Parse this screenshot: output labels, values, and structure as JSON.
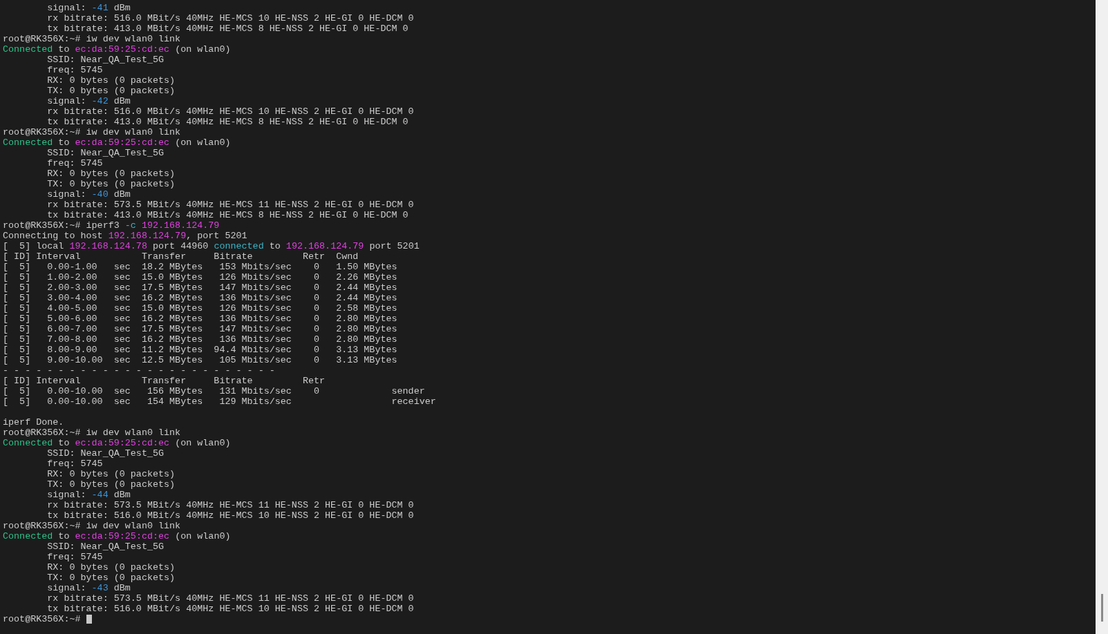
{
  "terminal": {
    "lines": [
      {
        "indent": true,
        "segments": [
          {
            "kind": "text",
            "text": "signal: "
          },
          {
            "kind": "number",
            "text": "-41"
          },
          {
            "kind": "text",
            "text": " dBm"
          }
        ]
      },
      {
        "indent": true,
        "segments": [
          {
            "kind": "text",
            "text": "rx bitrate: 516.0 MBit/s 40MHz HE-MCS 10 HE-NSS 2 HE-GI 0 HE-DCM 0"
          }
        ]
      },
      {
        "indent": true,
        "segments": [
          {
            "kind": "text",
            "text": "tx bitrate: 413.0 MBit/s 40MHz HE-MCS 8 HE-NSS 2 HE-GI 0 HE-DCM 0"
          }
        ]
      },
      {
        "indent": false,
        "segments": [
          {
            "kind": "text",
            "text": "root@RK356X:~# iw dev wlan0 link"
          }
        ]
      },
      {
        "indent": false,
        "segments": [
          {
            "kind": "status",
            "text": "Connected"
          },
          {
            "kind": "text",
            "text": " to "
          },
          {
            "kind": "address",
            "text": "ec:da:59:25:cd:ec"
          },
          {
            "kind": "text",
            "text": " (on wlan0)"
          }
        ]
      },
      {
        "indent": true,
        "segments": [
          {
            "kind": "text",
            "text": "SSID: Near_QA_Test_5G"
          }
        ]
      },
      {
        "indent": true,
        "segments": [
          {
            "kind": "text",
            "text": "freq: 5745"
          }
        ]
      },
      {
        "indent": true,
        "segments": [
          {
            "kind": "text",
            "text": "RX: 0 bytes (0 packets)"
          }
        ]
      },
      {
        "indent": true,
        "segments": [
          {
            "kind": "text",
            "text": "TX: 0 bytes (0 packets)"
          }
        ]
      },
      {
        "indent": true,
        "segments": [
          {
            "kind": "text",
            "text": "signal: "
          },
          {
            "kind": "number",
            "text": "-42"
          },
          {
            "kind": "text",
            "text": " dBm"
          }
        ]
      },
      {
        "indent": true,
        "segments": [
          {
            "kind": "text",
            "text": "rx bitrate: 516.0 MBit/s 40MHz HE-MCS 10 HE-NSS 2 HE-GI 0 HE-DCM 0"
          }
        ]
      },
      {
        "indent": true,
        "segments": [
          {
            "kind": "text",
            "text": "tx bitrate: 413.0 MBit/s 40MHz HE-MCS 8 HE-NSS 2 HE-GI 0 HE-DCM 0"
          }
        ]
      },
      {
        "indent": false,
        "segments": [
          {
            "kind": "text",
            "text": "root@RK356X:~# iw dev wlan0 link"
          }
        ]
      },
      {
        "indent": false,
        "segments": [
          {
            "kind": "status",
            "text": "Connected"
          },
          {
            "kind": "text",
            "text": " to "
          },
          {
            "kind": "address",
            "text": "ec:da:59:25:cd:ec"
          },
          {
            "kind": "text",
            "text": " (on wlan0)"
          }
        ]
      },
      {
        "indent": true,
        "segments": [
          {
            "kind": "text",
            "text": "SSID: Near_QA_Test_5G"
          }
        ]
      },
      {
        "indent": true,
        "segments": [
          {
            "kind": "text",
            "text": "freq: 5745"
          }
        ]
      },
      {
        "indent": true,
        "segments": [
          {
            "kind": "text",
            "text": "RX: 0 bytes (0 packets)"
          }
        ]
      },
      {
        "indent": true,
        "segments": [
          {
            "kind": "text",
            "text": "TX: 0 bytes (0 packets)"
          }
        ]
      },
      {
        "indent": true,
        "segments": [
          {
            "kind": "text",
            "text": "signal: "
          },
          {
            "kind": "number",
            "text": "-40"
          },
          {
            "kind": "text",
            "text": " dBm"
          }
        ]
      },
      {
        "indent": true,
        "segments": [
          {
            "kind": "text",
            "text": "rx bitrate: 573.5 MBit/s 40MHz HE-MCS 11 HE-NSS 2 HE-GI 0 HE-DCM 0"
          }
        ]
      },
      {
        "indent": true,
        "segments": [
          {
            "kind": "text",
            "text": "tx bitrate: 413.0 MBit/s 40MHz HE-MCS 8 HE-NSS 2 HE-GI 0 HE-DCM 0"
          }
        ]
      },
      {
        "indent": false,
        "segments": [
          {
            "kind": "text",
            "text": "root@RK356X:~# iperf3 "
          },
          {
            "kind": "keyword",
            "text": "-c "
          },
          {
            "kind": "address",
            "text": "192.168.124.79"
          }
        ]
      },
      {
        "indent": false,
        "segments": [
          {
            "kind": "text",
            "text": "Connecting to host "
          },
          {
            "kind": "address",
            "text": "192.168.124.79"
          },
          {
            "kind": "text",
            "text": ", port 5201"
          }
        ]
      },
      {
        "indent": false,
        "segments": [
          {
            "kind": "text",
            "text": "[  5] local "
          },
          {
            "kind": "address",
            "text": "192.168.124.78"
          },
          {
            "kind": "text",
            "text": " port 44960 "
          },
          {
            "kind": "keyword",
            "text": "connected"
          },
          {
            "kind": "text",
            "text": " to "
          },
          {
            "kind": "address",
            "text": "192.168.124.79"
          },
          {
            "kind": "text",
            "text": " port 5201"
          }
        ]
      },
      {
        "indent": false,
        "segments": [
          {
            "kind": "text",
            "text": "[ ID] Interval           Transfer     Bitrate         Retr  Cwnd"
          }
        ]
      },
      {
        "indent": false,
        "segments": [
          {
            "kind": "text",
            "text": "[  5]   0.00-1.00   sec  18.2 MBytes   153 Mbits/sec    0   1.50 MBytes"
          }
        ]
      },
      {
        "indent": false,
        "segments": [
          {
            "kind": "text",
            "text": "[  5]   1.00-2.00   sec  15.0 MBytes   126 Mbits/sec    0   2.26 MBytes"
          }
        ]
      },
      {
        "indent": false,
        "segments": [
          {
            "kind": "text",
            "text": "[  5]   2.00-3.00   sec  17.5 MBytes   147 Mbits/sec    0   2.44 MBytes"
          }
        ]
      },
      {
        "indent": false,
        "segments": [
          {
            "kind": "text",
            "text": "[  5]   3.00-4.00   sec  16.2 MBytes   136 Mbits/sec    0   2.44 MBytes"
          }
        ]
      },
      {
        "indent": false,
        "segments": [
          {
            "kind": "text",
            "text": "[  5]   4.00-5.00   sec  15.0 MBytes   126 Mbits/sec    0   2.58 MBytes"
          }
        ]
      },
      {
        "indent": false,
        "segments": [
          {
            "kind": "text",
            "text": "[  5]   5.00-6.00   sec  16.2 MBytes   136 Mbits/sec    0   2.80 MBytes"
          }
        ]
      },
      {
        "indent": false,
        "segments": [
          {
            "kind": "text",
            "text": "[  5]   6.00-7.00   sec  17.5 MBytes   147 Mbits/sec    0   2.80 MBytes"
          }
        ]
      },
      {
        "indent": false,
        "segments": [
          {
            "kind": "text",
            "text": "[  5]   7.00-8.00   sec  16.2 MBytes   136 Mbits/sec    0   2.80 MBytes"
          }
        ]
      },
      {
        "indent": false,
        "segments": [
          {
            "kind": "text",
            "text": "[  5]   8.00-9.00   sec  11.2 MBytes  94.4 Mbits/sec    0   3.13 MBytes"
          }
        ]
      },
      {
        "indent": false,
        "segments": [
          {
            "kind": "text",
            "text": "[  5]   9.00-10.00  sec  12.5 MBytes   105 Mbits/sec    0   3.13 MBytes"
          }
        ]
      },
      {
        "indent": false,
        "segments": [
          {
            "kind": "text",
            "text": "- - - - - - - - - - - - - - - - - - - - - - - - -"
          }
        ]
      },
      {
        "indent": false,
        "segments": [
          {
            "kind": "text",
            "text": "[ ID] Interval           Transfer     Bitrate         Retr"
          }
        ]
      },
      {
        "indent": false,
        "segments": [
          {
            "kind": "text",
            "text": "[  5]   0.00-10.00  sec   156 MBytes   131 Mbits/sec    0             sender"
          }
        ]
      },
      {
        "indent": false,
        "segments": [
          {
            "kind": "text",
            "text": "[  5]   0.00-10.00  sec   154 MBytes   129 Mbits/sec                  receiver"
          }
        ]
      },
      {
        "indent": false,
        "gap_before": true,
        "segments": [
          {
            "kind": "text",
            "text": "iperf Done."
          }
        ]
      },
      {
        "indent": false,
        "segments": [
          {
            "kind": "text",
            "text": "root@RK356X:~# iw dev wlan0 link"
          }
        ]
      },
      {
        "indent": false,
        "segments": [
          {
            "kind": "status",
            "text": "Connected"
          },
          {
            "kind": "text",
            "text": " to "
          },
          {
            "kind": "address",
            "text": "ec:da:59:25:cd:ec"
          },
          {
            "kind": "text",
            "text": " (on wlan0)"
          }
        ]
      },
      {
        "indent": true,
        "segments": [
          {
            "kind": "text",
            "text": "SSID: Near_QA_Test_5G"
          }
        ]
      },
      {
        "indent": true,
        "segments": [
          {
            "kind": "text",
            "text": "freq: 5745"
          }
        ]
      },
      {
        "indent": true,
        "segments": [
          {
            "kind": "text",
            "text": "RX: 0 bytes (0 packets)"
          }
        ]
      },
      {
        "indent": true,
        "segments": [
          {
            "kind": "text",
            "text": "TX: 0 bytes (0 packets)"
          }
        ]
      },
      {
        "indent": true,
        "segments": [
          {
            "kind": "text",
            "text": "signal: "
          },
          {
            "kind": "number",
            "text": "-44"
          },
          {
            "kind": "text",
            "text": " dBm"
          }
        ]
      },
      {
        "indent": true,
        "segments": [
          {
            "kind": "text",
            "text": "rx bitrate: 573.5 MBit/s 40MHz HE-MCS 11 HE-NSS 2 HE-GI 0 HE-DCM 0"
          }
        ]
      },
      {
        "indent": true,
        "segments": [
          {
            "kind": "text",
            "text": "tx bitrate: 516.0 MBit/s 40MHz HE-MCS 10 HE-NSS 2 HE-GI 0 HE-DCM 0"
          }
        ]
      },
      {
        "indent": false,
        "segments": [
          {
            "kind": "text",
            "text": "root@RK356X:~# iw dev wlan0 link"
          }
        ]
      },
      {
        "indent": false,
        "segments": [
          {
            "kind": "status",
            "text": "Connected"
          },
          {
            "kind": "text",
            "text": " to "
          },
          {
            "kind": "address",
            "text": "ec:da:59:25:cd:ec"
          },
          {
            "kind": "text",
            "text": " (on wlan0)"
          }
        ]
      },
      {
        "indent": true,
        "segments": [
          {
            "kind": "text",
            "text": "SSID: Near_QA_Test_5G"
          }
        ]
      },
      {
        "indent": true,
        "segments": [
          {
            "kind": "text",
            "text": "freq: 5745"
          }
        ]
      },
      {
        "indent": true,
        "segments": [
          {
            "kind": "text",
            "text": "RX: 0 bytes (0 packets)"
          }
        ]
      },
      {
        "indent": true,
        "segments": [
          {
            "kind": "text",
            "text": "TX: 0 bytes (0 packets)"
          }
        ]
      },
      {
        "indent": true,
        "segments": [
          {
            "kind": "text",
            "text": "signal: "
          },
          {
            "kind": "number",
            "text": "-43"
          },
          {
            "kind": "text",
            "text": " dBm"
          }
        ]
      },
      {
        "indent": true,
        "segments": [
          {
            "kind": "text",
            "text": "rx bitrate: 573.5 MBit/s 40MHz HE-MCS 11 HE-NSS 2 HE-GI 0 HE-DCM 0"
          }
        ]
      },
      {
        "indent": true,
        "segments": [
          {
            "kind": "text",
            "text": "tx bitrate: 516.0 MBit/s 40MHz HE-MCS 10 HE-NSS 2 HE-GI 0 HE-DCM 0"
          }
        ]
      },
      {
        "indent": false,
        "cursor": true,
        "segments": [
          {
            "kind": "text",
            "text": "root@RK356X:~#"
          }
        ]
      }
    ]
  }
}
